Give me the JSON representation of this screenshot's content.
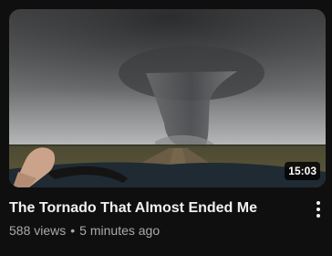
{
  "video": {
    "title": "The Tornado That Almost Ended Me",
    "views": "588 views",
    "separator": "•",
    "age": "5 minutes ago",
    "duration": "15:03"
  },
  "icons": {
    "menu": "more-vert-icon"
  },
  "colors": {
    "background": "#0f0f0f",
    "title": "#f1f1f1",
    "meta": "#aaaaaa"
  }
}
